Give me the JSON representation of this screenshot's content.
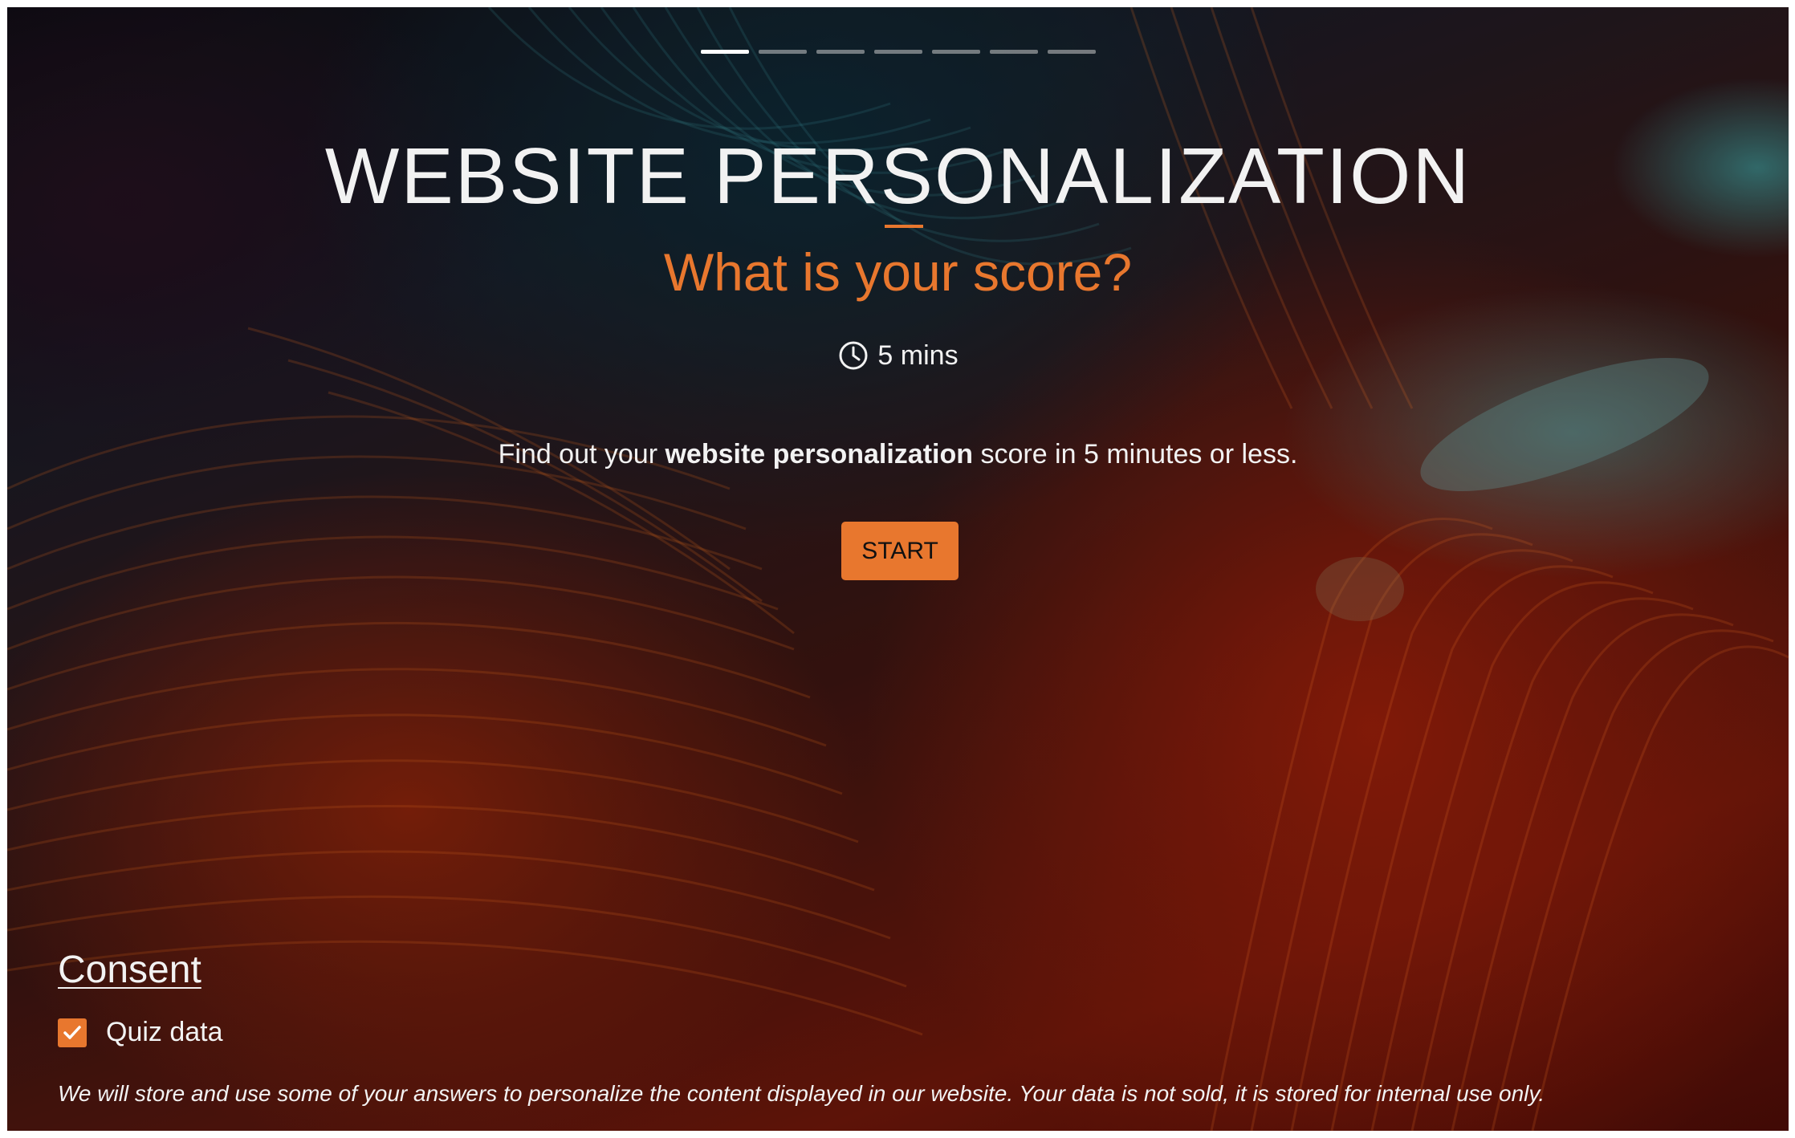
{
  "progress": {
    "total_steps": 7,
    "current_step": 1
  },
  "hero": {
    "title": "WEBSITE PERSONALIZATION",
    "subtitle": "What is your score?",
    "duration_label": "5 mins",
    "duration_icon": "clock-icon",
    "description_prefix": "Find out your ",
    "description_bold": "website personalization",
    "description_suffix": " score in 5 minutes or less.",
    "start_label": "START"
  },
  "consent": {
    "heading": "Consent",
    "checkbox_label": "Quiz data",
    "checkbox_checked": true,
    "note": "We will store and use some of your answers to personalize the content displayed in our website. Your data is not sold, it is stored for internal use only."
  },
  "colors": {
    "accent": "#e8772e",
    "text": "#f2f2f2"
  }
}
